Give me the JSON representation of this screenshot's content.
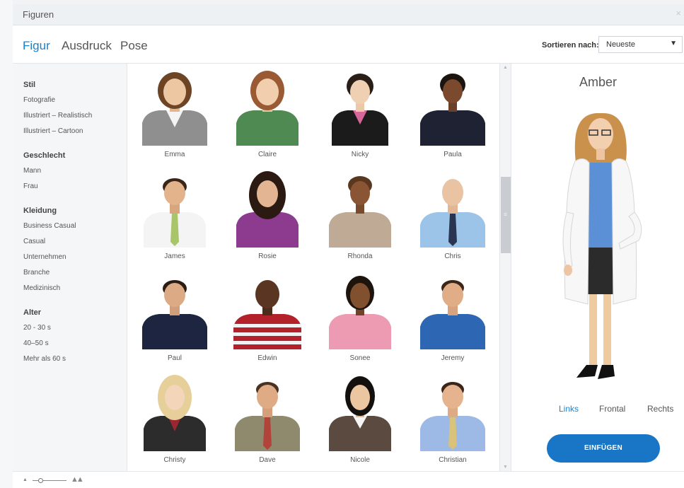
{
  "window": {
    "title": "Figuren",
    "close_icon": "×"
  },
  "tabs": [
    {
      "label": "Figur",
      "active": true
    },
    {
      "label": "Ausdruck",
      "active": false
    },
    {
      "label": "Pose",
      "active": false
    }
  ],
  "sort": {
    "label": "Sortieren nach:",
    "value": "Neueste"
  },
  "filters": {
    "stil": {
      "heading": "Stil",
      "items": [
        "Fotografie",
        "Illustriert – Realistisch",
        "Illustriert – Cartoon"
      ]
    },
    "geschlecht": {
      "heading": "Geschlecht",
      "items": [
        "Mann",
        "Frau"
      ]
    },
    "kleidung": {
      "heading": "Kleidung",
      "items": [
        "Business Casual",
        "Casual",
        "Unternehmen",
        "Branche",
        "Medizinisch"
      ]
    },
    "alter": {
      "heading": "Alter",
      "items": [
        "20 - 30 s",
        "40–50 s",
        "Mehr als 60 s"
      ]
    }
  },
  "characters": [
    {
      "name": "Emma"
    },
    {
      "name": "Claire"
    },
    {
      "name": "Nicky"
    },
    {
      "name": "Paula"
    },
    {
      "name": "James"
    },
    {
      "name": "Rosie"
    },
    {
      "name": "Rhonda"
    },
    {
      "name": "Chris"
    },
    {
      "name": "Paul"
    },
    {
      "name": "Edwin"
    },
    {
      "name": "Sonee"
    },
    {
      "name": "Jeremy"
    },
    {
      "name": "Christy"
    },
    {
      "name": "Dave"
    },
    {
      "name": "Nicole"
    },
    {
      "name": "Christian"
    }
  ],
  "preview": {
    "name": "Amber",
    "views": [
      {
        "label": "Links",
        "active": true
      },
      {
        "label": "Frontal",
        "active": false
      },
      {
        "label": "Rechts",
        "active": false
      }
    ],
    "insert_label": "EINFÜGEN"
  },
  "colors": {
    "accent": "#1a82c9",
    "button": "#1976c6"
  }
}
